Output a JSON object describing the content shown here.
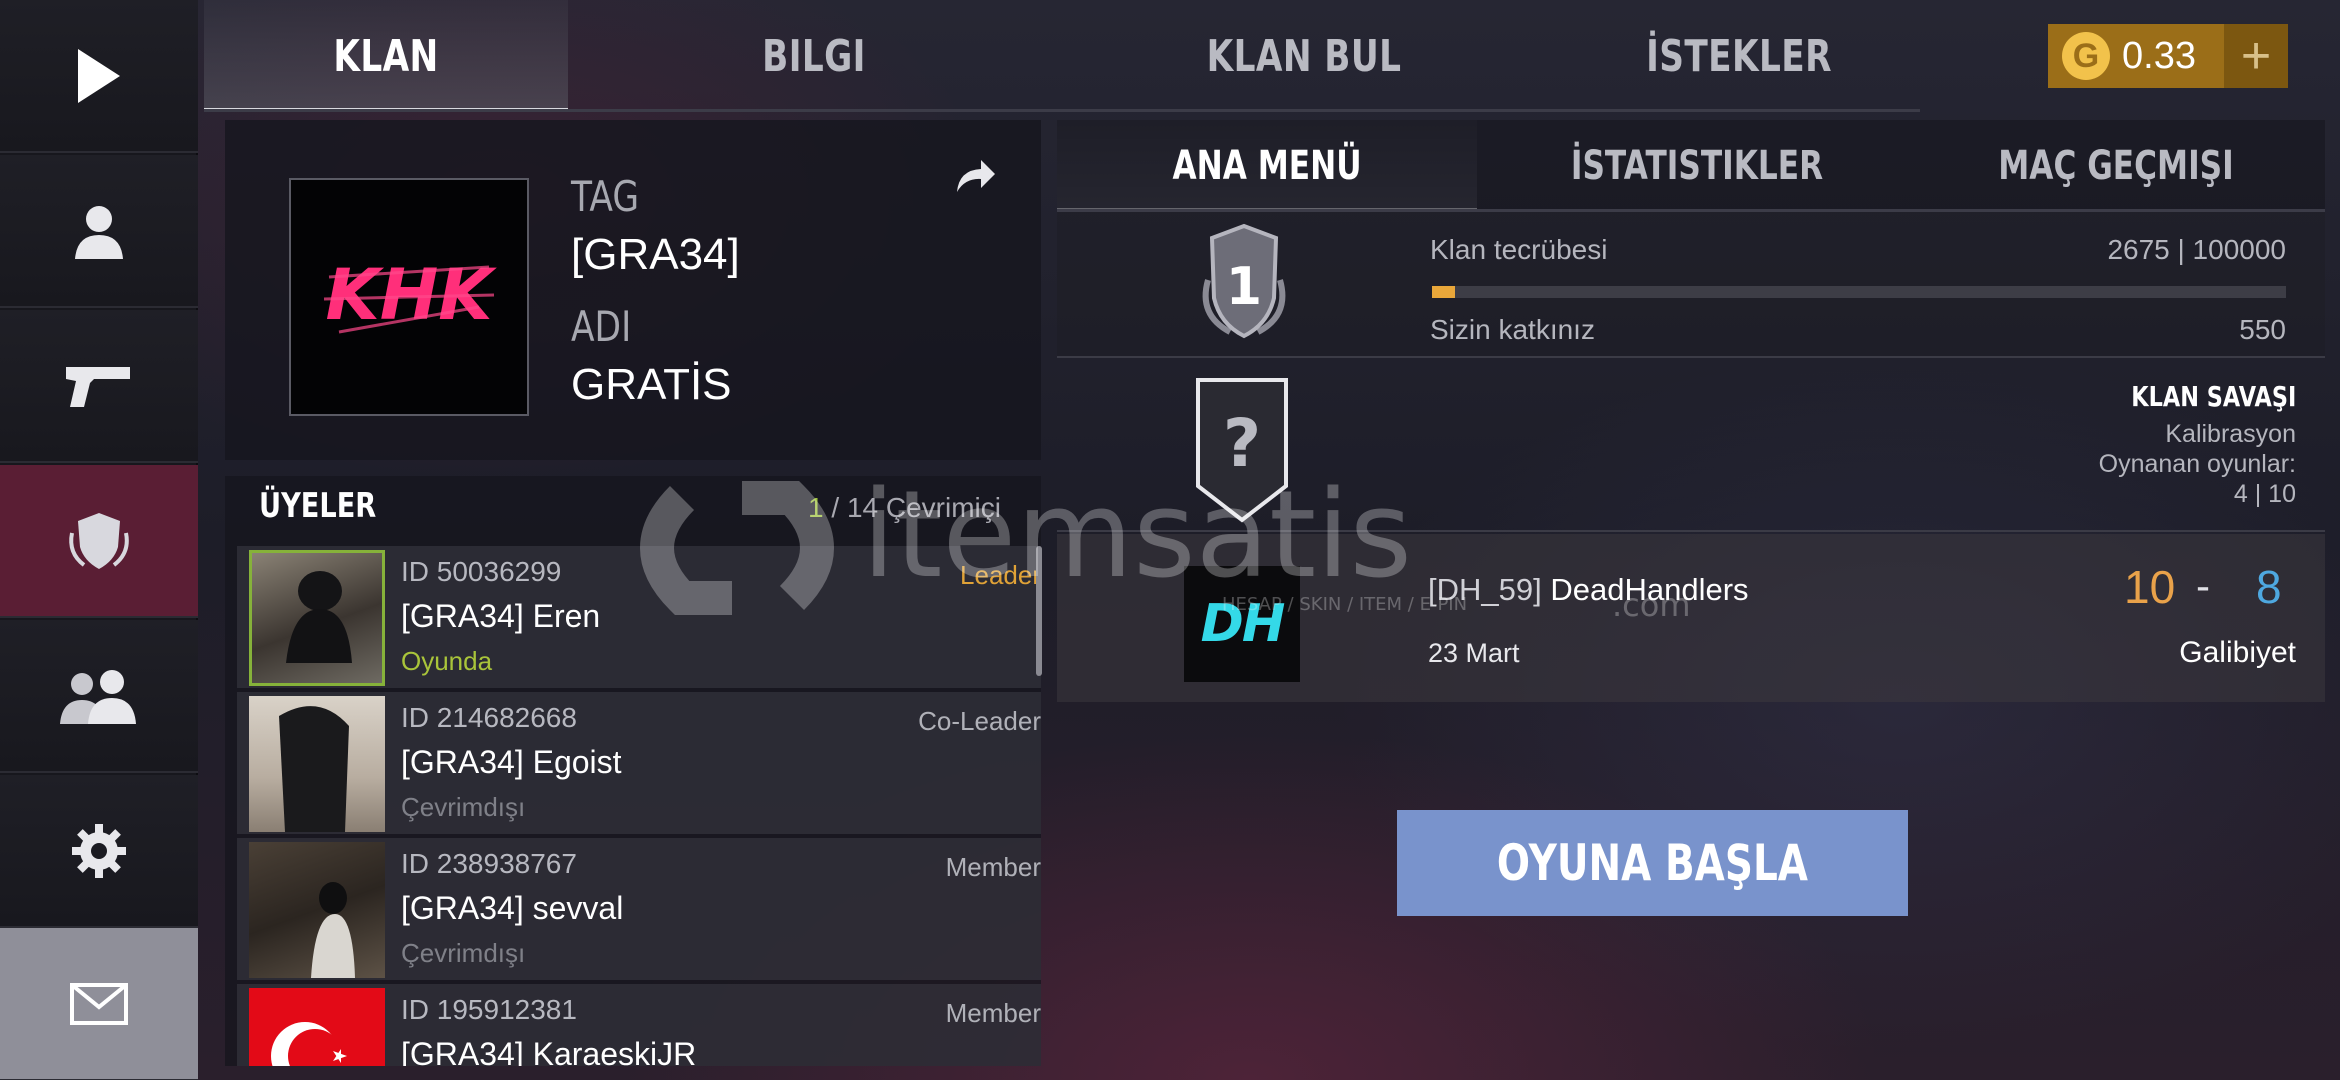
{
  "top_tabs": [
    {
      "label": "KLAN",
      "active": true
    },
    {
      "label": "BILGI",
      "active": false
    },
    {
      "label": "KLAN BUL",
      "active": false
    },
    {
      "label": "İSTEKLER",
      "active": false
    }
  ],
  "currency": {
    "symbol": "G",
    "value": "0.33",
    "add_label": "+"
  },
  "rail": {
    "icons": [
      "play-icon",
      "profile-icon",
      "pistol-icon",
      "clan-shield-icon",
      "friends-icon",
      "gear-icon",
      "mail-icon"
    ],
    "active": "clan-shield-icon"
  },
  "clan": {
    "tag_label": "TAG",
    "tag_value": "[GRA34]",
    "name_label": "ADI",
    "name_value": "GRATİS",
    "logo_text": "KHK"
  },
  "members": {
    "title": "ÜYELER",
    "online": "1",
    "total": "/ 14 Çevrimiçi",
    "rows": [
      {
        "id": "ID 50036299",
        "name": "[GRA34] Eren",
        "status": "Oyunda",
        "role": "Leader"
      },
      {
        "id": "ID 214682668",
        "name": "[GRA34] Egoist",
        "status": "Çevrimdışı",
        "role": "Co-Leader"
      },
      {
        "id": "ID 238938767",
        "name": "[GRA34] sevval",
        "status": "Çevrimdışı",
        "role": "Member"
      },
      {
        "id": "ID 195912381",
        "name": "[GRA34] KaraeskiJR",
        "status": "",
        "role": "Member"
      }
    ]
  },
  "sub_tabs": [
    {
      "label": "ANA MENÜ",
      "active": true
    },
    {
      "label": "İSTATISTIKLER",
      "active": false
    },
    {
      "label": "MAÇ GEÇMIŞI",
      "active": false
    }
  ],
  "experience": {
    "level": "1",
    "label": "Klan tecrübesi",
    "value": "2675 | 100000",
    "progress_fraction": 0.02675,
    "contribution_label": "Sizin katkınız",
    "contribution_value": "550"
  },
  "clan_war": {
    "badge": "?",
    "title": "KLAN SAVAŞI",
    "phase": "Kalibrasyon",
    "games_label": "Oynanan oyunlar:",
    "games_value": "4 | 10"
  },
  "last_match": {
    "opponent_logo": "DH",
    "opponent_tag": "[DH_59]",
    "opponent_name": "DeadHandlers",
    "date": "23 Mart",
    "score_ours": "10",
    "score_sep": "-",
    "score_theirs": "8",
    "result": "Galibiyet"
  },
  "play_button": "OYUNA BAŞLA",
  "watermark": {
    "brand": "itemsatis",
    "tagline": "HESAP / SKIN / ITEM / E-PIN",
    "domain": ".com"
  },
  "colors": {
    "accent_gold": "#e9a73a",
    "playing_green": "#a9c43a",
    "score_blue": "#4ea8e0",
    "play_button": "#7993cc",
    "currency_bg": "#9b6e18"
  }
}
